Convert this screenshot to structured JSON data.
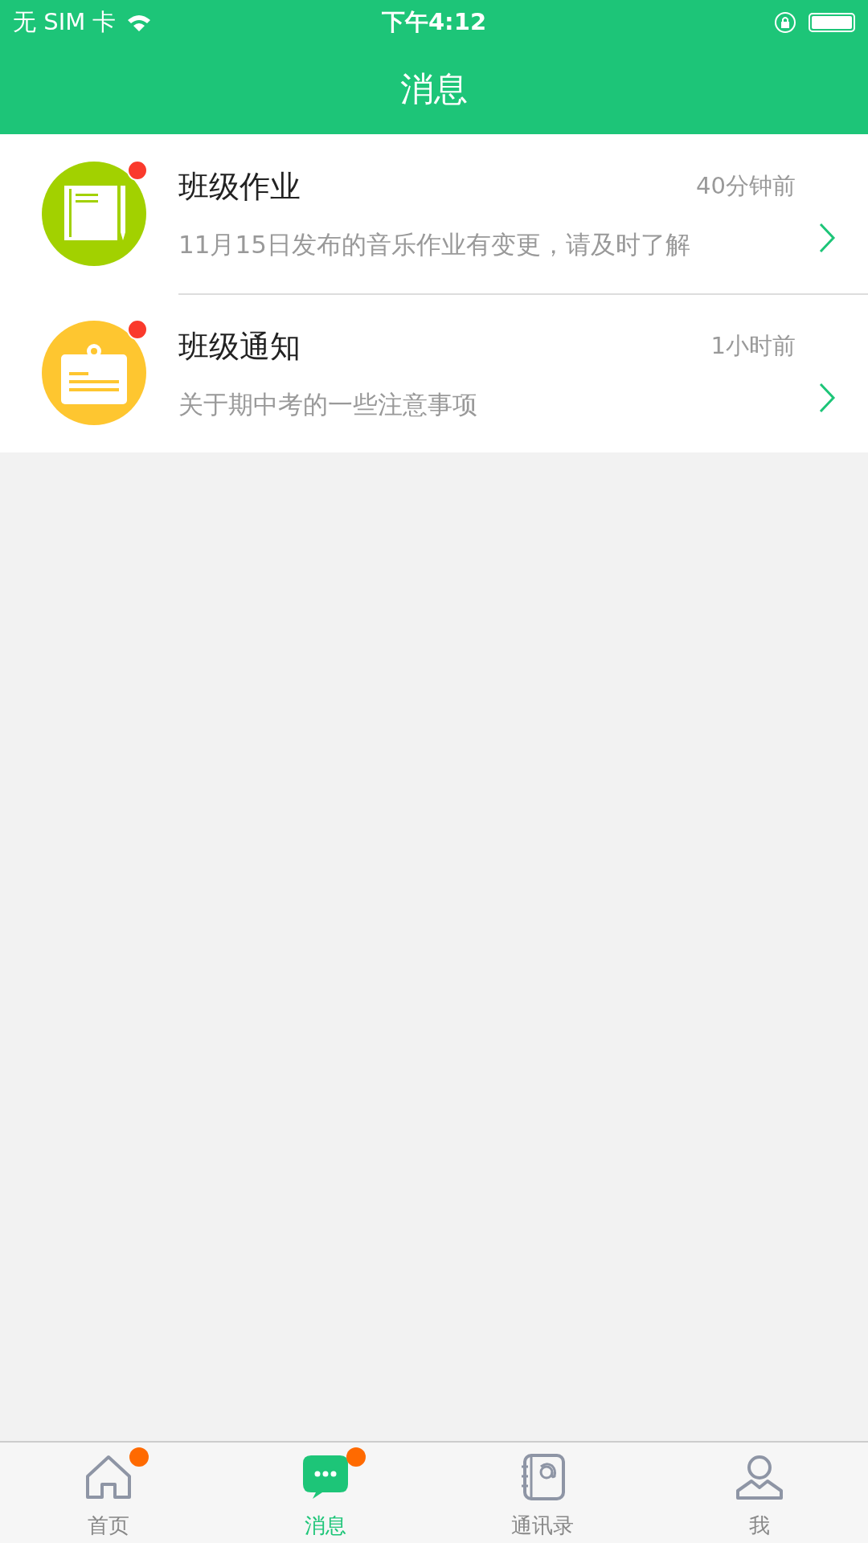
{
  "status_bar": {
    "carrier": "无 SIM 卡",
    "time": "下午4:12"
  },
  "nav": {
    "title": "消息"
  },
  "messages": [
    {
      "kind": "homework",
      "title": "班级作业",
      "time": "40分钟前",
      "preview": "11月15日发布的音乐作业有变更，请及时了解",
      "unread": true,
      "color": "#a2d100"
    },
    {
      "kind": "notice",
      "title": "班级通知",
      "time": "1小时前",
      "preview": "关于期中考的一些注意事项",
      "unread": true,
      "color": "#fec630"
    }
  ],
  "tabs": [
    {
      "kind": "home",
      "label": "首页",
      "selected": false,
      "badge": true
    },
    {
      "kind": "messages",
      "label": "消息",
      "selected": true,
      "badge": true
    },
    {
      "kind": "contacts",
      "label": "通讯录",
      "selected": false,
      "badge": false
    },
    {
      "kind": "me",
      "label": "我",
      "selected": false,
      "badge": false
    }
  ]
}
